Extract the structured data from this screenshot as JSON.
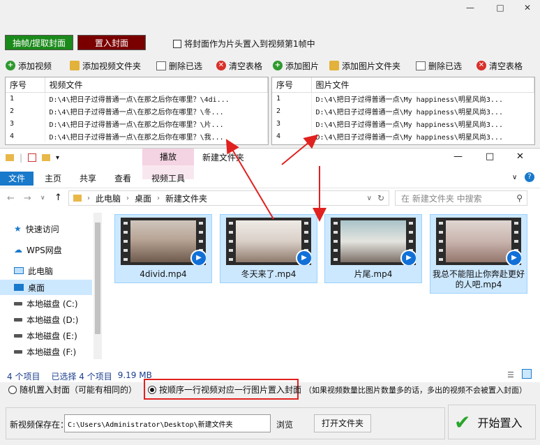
{
  "window_controls": {
    "minimize": "—",
    "maximize": "□",
    "close": "✕"
  },
  "top_buttons": {
    "extract": "抽帧/提取封面",
    "insert": "置入封面",
    "checkbox_label": "将封面作为片头置入到视频第1帧中"
  },
  "left_toolbar": [
    {
      "icon": "add-icon",
      "label": "添加视频"
    },
    {
      "icon": "folder-icon",
      "label": "添加视频文件夹"
    },
    {
      "icon": "delete-icon",
      "label": "删除已选"
    },
    {
      "icon": "clear-icon",
      "label": "清空表格"
    }
  ],
  "right_toolbar": [
    {
      "icon": "add-icon",
      "label": "添加图片"
    },
    {
      "icon": "folder-icon",
      "label": "添加图片文件夹"
    },
    {
      "icon": "delete-icon",
      "label": "删除已选"
    },
    {
      "icon": "clear-icon",
      "label": "清空表格"
    }
  ],
  "video_table": {
    "headers": [
      "序号",
      "视频文件"
    ],
    "rows": [
      [
        "1",
        "D:\\4\\把日子过得普通一点\\在那之后你在哪里？\\4di..."
      ],
      [
        "2",
        "D:\\4\\把日子过得普通一点\\在那之后你在哪里？\\冬..."
      ],
      [
        "3",
        "D:\\4\\把日子过得普通一点\\在那之后你在哪里？\\片..."
      ],
      [
        "4",
        "D:\\4\\把日子过得普通一点\\在那之后你在哪里？\\我..."
      ]
    ]
  },
  "image_table": {
    "headers": [
      "序号",
      "图片文件"
    ],
    "rows": [
      [
        "1",
        "D:\\4\\把日子过得普通一点\\My happiness\\明星风尚3..."
      ],
      [
        "2",
        "D:\\4\\把日子过得普通一点\\My happiness\\明星风尚3..."
      ],
      [
        "3",
        "D:\\4\\把日子过得普通一点\\My happiness\\明星风尚3..."
      ],
      [
        "4",
        "D:\\4\\把日子过得普通一点\\My happiness\\明星风尚3..."
      ]
    ]
  },
  "explorer": {
    "title": "新建文件夹",
    "context_tab": "播放",
    "context_subtab": "视频工具",
    "tabs": [
      "文件",
      "主页",
      "共享",
      "查看"
    ],
    "breadcrumb": [
      "此电脑",
      "桌面",
      "新建文件夹"
    ],
    "search_placeholder": "在 新建文件夹 中搜索",
    "nav": [
      {
        "icon": "star-icon",
        "label": "快速访问"
      },
      {
        "icon": "cloud-icon",
        "label": "WPS网盘"
      },
      {
        "icon": "computer-icon",
        "label": "此电脑"
      },
      {
        "icon": "desktop-icon",
        "label": "桌面"
      },
      {
        "icon": "drive-icon",
        "label": "本地磁盘 (C:)"
      },
      {
        "icon": "drive-icon",
        "label": "本地磁盘 (D:)"
      },
      {
        "icon": "drive-icon",
        "label": "本地磁盘 (E:)"
      },
      {
        "icon": "drive-icon",
        "label": "本地磁盘 (F:)"
      }
    ],
    "files": [
      {
        "name": "4divid.mp4"
      },
      {
        "name": "冬天来了.mp4"
      },
      {
        "name": "片尾.mp4"
      },
      {
        "name": "我总不能阻止你奔赴更好的人吧.mp4"
      }
    ],
    "status": {
      "count": "4 个项目",
      "selected": "已选择 4 个项目",
      "size": "9.19 MB"
    }
  },
  "mode": {
    "random_label": "随机置入封面（可能有相同的）",
    "sequential_label": "按顺序一行视频对应一行图片置入封面",
    "note": "（如果视频数量比图片数量多的话，多出的视频不会被置入封面）"
  },
  "save": {
    "label": "新视频保存在：",
    "path": "C:\\Users\\Administrator\\Desktop\\新建文件夹",
    "browse": "浏览",
    "open_folder": "打开文件夹",
    "start": "开始置入"
  },
  "colors": {
    "extract_btn": "#1a8a1a",
    "insert_btn": "#7a0000",
    "highlight_red": "#e0211f",
    "selection_blue": "#cce8ff"
  }
}
